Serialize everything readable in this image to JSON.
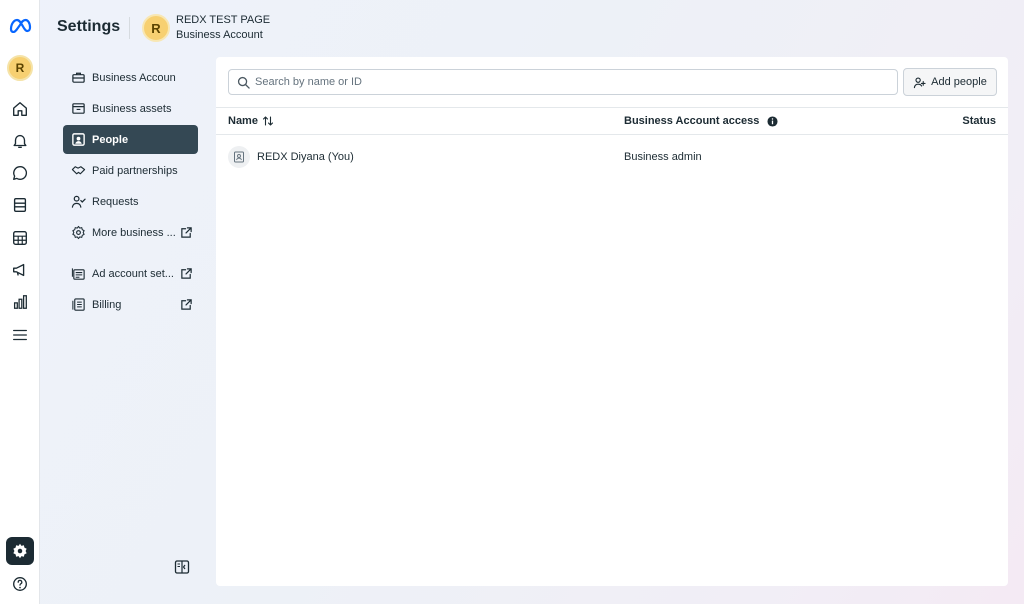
{
  "header": {
    "title": "Settings",
    "account_initial": "R",
    "account_name": "REDX TEST PAGE",
    "account_type": "Business Account"
  },
  "rail": {
    "avatar_initial": "R",
    "items": [
      {
        "icon": "home-icon"
      },
      {
        "icon": "bell-icon"
      },
      {
        "icon": "chat-icon"
      },
      {
        "icon": "pages-icon"
      },
      {
        "icon": "table-icon"
      },
      {
        "icon": "megaphone-icon"
      },
      {
        "icon": "bar-chart-icon"
      },
      {
        "icon": "menu-icon"
      },
      {
        "icon": "gear-icon"
      },
      {
        "icon": "help-icon"
      }
    ]
  },
  "nav": {
    "items": [
      {
        "label": "Business Accoun",
        "icon": "briefcase-icon",
        "external": false
      },
      {
        "label": "Business assets",
        "icon": "archive-box-icon",
        "external": false
      },
      {
        "label": "People",
        "icon": "people-badge-icon",
        "external": false,
        "active": true
      },
      {
        "label": "Paid partnerships",
        "icon": "handshake-icon",
        "external": false
      },
      {
        "label": "Requests",
        "icon": "person-check-icon",
        "external": false
      },
      {
        "label": "More business ...",
        "icon": "gear-icon",
        "external": true
      },
      {
        "label": "Ad account set...",
        "icon": "ad-account-icon",
        "external": true
      },
      {
        "label": "Billing",
        "icon": "billing-icon",
        "external": true
      }
    ]
  },
  "main": {
    "search_placeholder": "Search by name or ID",
    "add_button_label": "Add people",
    "columns": [
      "Name",
      "Business Account access",
      "Status"
    ],
    "rows": [
      {
        "name": "REDX Diyana (You)",
        "access": "Business admin",
        "status": ""
      }
    ]
  },
  "colors": {
    "active_nav_bg": "#344854",
    "avatar_yellow": "#f7d071",
    "meta_blue": "#0866ff"
  }
}
